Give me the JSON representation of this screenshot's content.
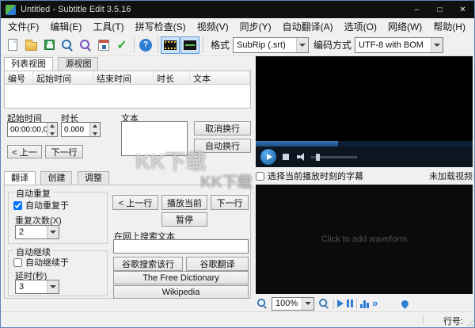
{
  "window": {
    "title": "Untitled - Subtitle Edit 3.5.16",
    "minimize": "–",
    "maximize": "□",
    "close": "✕"
  },
  "menu": {
    "items": [
      "文件(F)",
      "编辑(E)",
      "工具(T)",
      "拼写检查(S)",
      "视频(V)",
      "同步(Y)",
      "自动翻译(A)",
      "选项(O)",
      "网络(W)",
      "帮助(H)"
    ]
  },
  "toolbar": {
    "format_label": "格式",
    "format_value": "SubRip (.srt)",
    "encoding_label": "编码方式",
    "encoding_value": "UTF-8 with BOM"
  },
  "view_tabs": {
    "list": "列表视图",
    "source": "源视图"
  },
  "subtitle_table": {
    "columns": [
      "编号",
      "起始时间",
      "结束时间",
      "时长",
      "文本"
    ]
  },
  "editor": {
    "start_label": "起始时间",
    "duration_label": "时长",
    "text_label": "文本",
    "start_value": "00:00:00,000",
    "duration_value": "0.000",
    "unbreak": "取消换行",
    "autobreak": "自动换行",
    "prev": "< 上一",
    "next": "下一行"
  },
  "panel_tabs": {
    "translate": "翻译",
    "create": "创建",
    "adjust": "调整"
  },
  "translate": {
    "auto_repeat_title": "自动重复",
    "auto_repeat_check": "自动重复于",
    "auto_repeat_checked": true,
    "repeat_count_label": "重复次数(X)",
    "repeat_count_value": "2",
    "auto_continue_title": "自动继续",
    "auto_continue_check": "自动继续于",
    "auto_continue_checked": false,
    "delay_label": "延时(秒)",
    "delay_value": "3",
    "prev_line": "< 上一行",
    "play_current": "播放当前",
    "next_line": "下一行",
    "pause": "暂停",
    "search_label": "在网上搜索文本",
    "search_value": "",
    "google_search": "谷歌搜索该行",
    "google_translate": "谷歌翻译",
    "free_dictionary": "The Free Dictionary",
    "wikipedia": "Wikipedia"
  },
  "video": {
    "select_sub_label": "选择当前播放时刻的字幕",
    "select_sub_checked": false,
    "no_video": "未加载视频"
  },
  "waveform": {
    "hint": "Click to add waveform",
    "zoom": "100%"
  },
  "status": {
    "line_label": "行号:"
  },
  "watermark": {
    "text": "KK下载"
  }
}
